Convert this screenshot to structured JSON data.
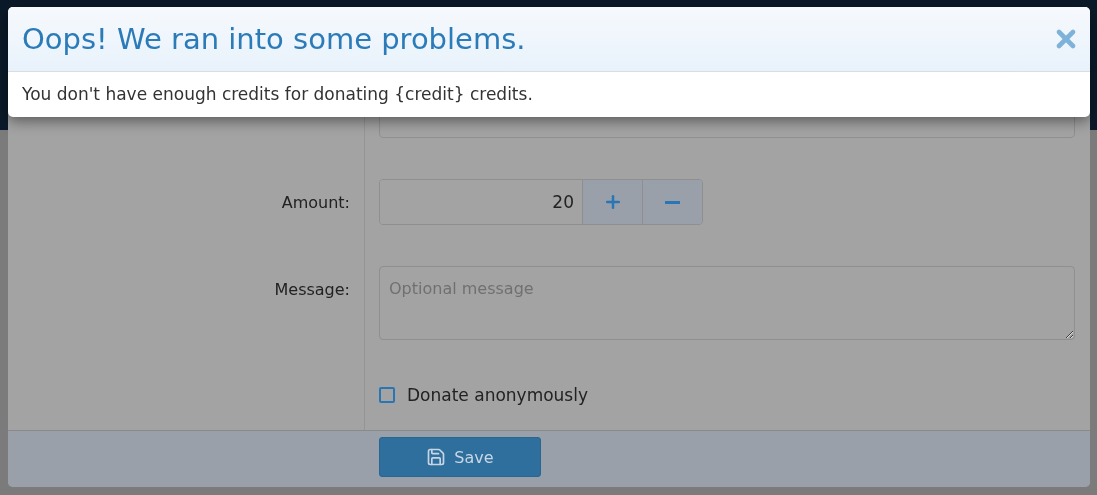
{
  "alert": {
    "title": "Oops! We ran into some problems.",
    "message": "You don't have enough credits for donating {credit} credits."
  },
  "form": {
    "fields": [
      {
        "kind": "text"
      },
      {
        "kind": "stepper",
        "label": "Amount:",
        "value": "20"
      },
      {
        "kind": "textarea",
        "label": "Message:",
        "placeholder": "Optional message"
      }
    ],
    "anonymous": {
      "label": "Donate anonymously",
      "checked": false
    }
  },
  "footer": {
    "save": "Save"
  }
}
